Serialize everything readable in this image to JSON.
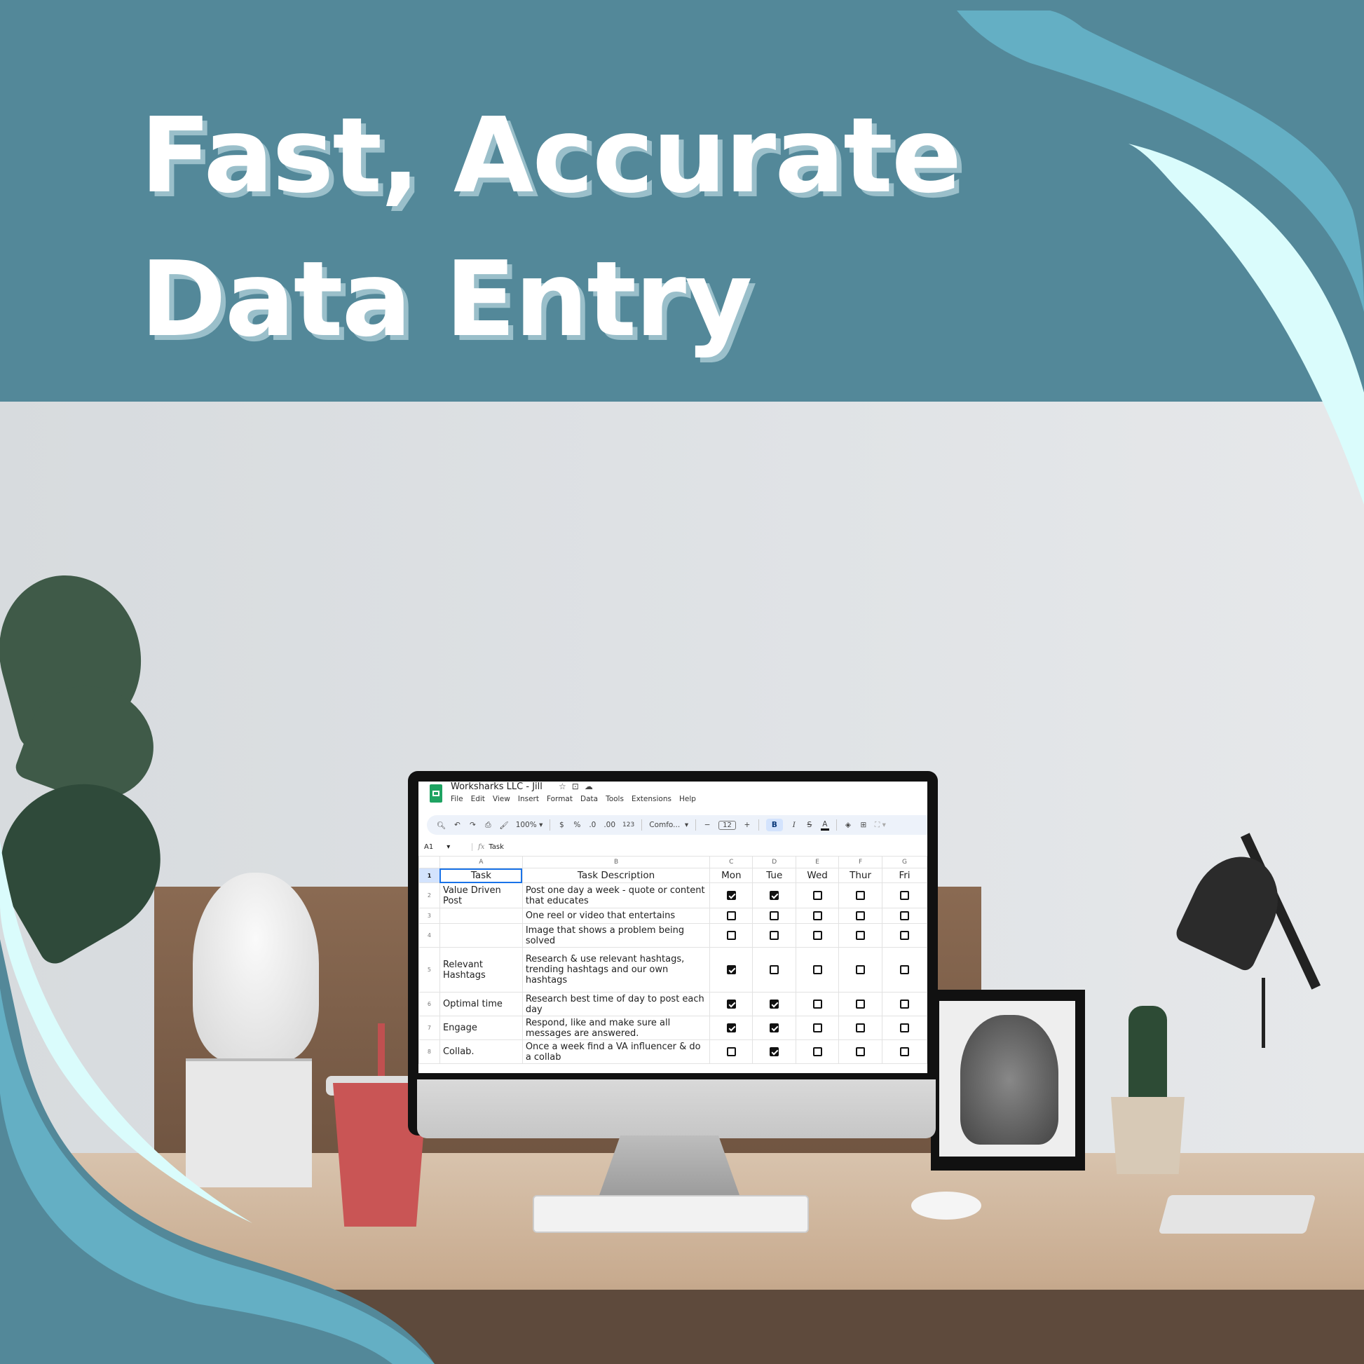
{
  "headline": {
    "line1": "Fast, Accurate",
    "line2": "Data Entry"
  },
  "colors": {
    "banner": "#538899",
    "wave_mid": "#64afc4",
    "wave_light": "#dafcfc",
    "headline_shadow": "#9abfca",
    "sheets_green": "#1ea362",
    "selection_blue": "#1a73e8"
  },
  "spreadsheet": {
    "doc_title": "Worksharks LLC - Jill",
    "title_icons": [
      "star-icon",
      "move-to-folder-icon",
      "cloud-saved-icon"
    ],
    "menu": [
      "File",
      "Edit",
      "View",
      "Insert",
      "Format",
      "Data",
      "Tools",
      "Extensions",
      "Help"
    ],
    "toolbar": {
      "zoom": "100%",
      "currency": "$",
      "percent": "%",
      "decrease_decimal": ".0",
      "increase_decimal": ".00",
      "number_format": "123",
      "font": "Comfo...",
      "font_size_minus": "−",
      "font_size": "12",
      "font_size_plus": "+",
      "bold": "B",
      "italic": "I",
      "strikethrough": "S",
      "text_color": "A"
    },
    "name_box": "A1",
    "formula": "Task",
    "column_letters": [
      "A",
      "B",
      "C",
      "D",
      "E",
      "F",
      "G"
    ],
    "headers": [
      "Task",
      "Task Description",
      "Mon",
      "Tue",
      "Wed",
      "Thur",
      "Fri"
    ],
    "rows": [
      {
        "num": "2",
        "task": "Value Driven Post",
        "desc": "Post one day a week - quote or content that educates",
        "checks": [
          true,
          true,
          false,
          false,
          false
        ]
      },
      {
        "num": "3",
        "task": "",
        "desc": "One reel or video that entertains",
        "checks": [
          false,
          false,
          false,
          false,
          false
        ]
      },
      {
        "num": "4",
        "task": "",
        "desc": "Image that shows a problem being solved",
        "checks": [
          false,
          false,
          false,
          false,
          false
        ]
      },
      {
        "num": "5",
        "task": "Relevant Hashtags",
        "desc": "Research & use relevant hashtags, trending hashtags and our own hashtags",
        "checks": [
          true,
          false,
          false,
          false,
          false
        ]
      },
      {
        "num": "6",
        "task": "Optimal time",
        "desc": "Research best time of day to post each day",
        "checks": [
          true,
          true,
          false,
          false,
          false
        ]
      },
      {
        "num": "7",
        "task": "Engage",
        "desc": "Respond, like and make sure all messages are answered.",
        "checks": [
          true,
          true,
          false,
          false,
          false
        ]
      },
      {
        "num": "8",
        "task": "Collab.",
        "desc": "Once a week find a VA influencer & do a collab",
        "checks": [
          false,
          true,
          false,
          false,
          false
        ]
      }
    ],
    "header_row_num": "1"
  }
}
